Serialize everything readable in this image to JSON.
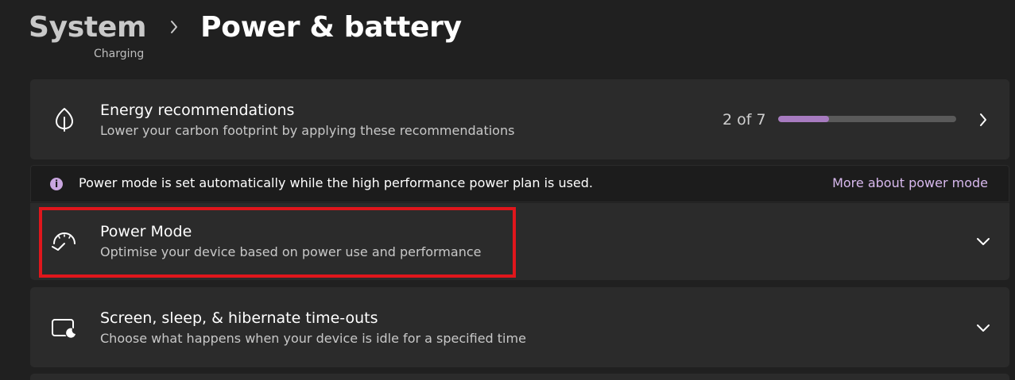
{
  "header": {
    "parent": "System",
    "current": "Power & battery"
  },
  "clipped_text": "Charging",
  "energy": {
    "title": "Energy recommendations",
    "subtitle": "Lower your carbon footprint by applying these recommendations",
    "progress_label": "2 of 7",
    "progress_fraction": 0.2857,
    "icon": "leaf-icon"
  },
  "info_bar": {
    "icon": "i",
    "message": "Power mode is set automatically while the high performance power plan is used.",
    "link": "More about power mode"
  },
  "power_mode": {
    "title": "Power Mode",
    "subtitle": "Optimise your device based on power use and performance",
    "icon": "speedometer-icon"
  },
  "screen_sleep": {
    "title": "Screen, sleep, & hibernate time-outs",
    "subtitle": "Choose what happens when your device is idle for a specified time",
    "icon": "screen-sleep-icon"
  },
  "colors": {
    "background": "#202020",
    "card": "#2b2b2b",
    "accent": "#a77bc0",
    "link": "#d8b9ee",
    "highlight": "#e0161c"
  }
}
